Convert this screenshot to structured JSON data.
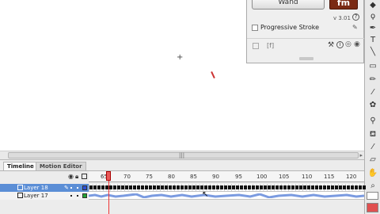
{
  "wand_panel": {
    "button_label": "Wand",
    "logo_text": "fm",
    "version": "v 3.01",
    "progressive_stroke_label": "Progressive Stroke",
    "bracket_label": "[f]"
  },
  "timeline": {
    "tabs": [
      "Timeline",
      "Motion Editor"
    ],
    "frame_labels": [
      "65",
      "70",
      "75",
      "80",
      "85",
      "90",
      "95",
      "100",
      "105",
      "110",
      "115",
      "120"
    ],
    "current_frame": 65,
    "layers": [
      {
        "name": "Layer 18",
        "selected": true,
        "color": "#2b4fd6"
      },
      {
        "name": "Layer 17",
        "selected": false,
        "color": "#25a235"
      }
    ]
  },
  "colors": {
    "selection": "#5b8ed6",
    "playhead": "#e33333",
    "stroke_color": "#ffffff",
    "fill_color": "#e05050"
  },
  "icons": {
    "tools": [
      "subselect-icon",
      "lasso-icon",
      "pen-icon",
      "text-icon",
      "line-icon",
      "rectangle-icon",
      "pencil-icon",
      "brush-icon",
      "deco-icon",
      "bone-icon",
      "paint-bucket-icon",
      "eyedropper-icon",
      "eraser-icon",
      "hand-icon",
      "zoom-icon"
    ]
  }
}
